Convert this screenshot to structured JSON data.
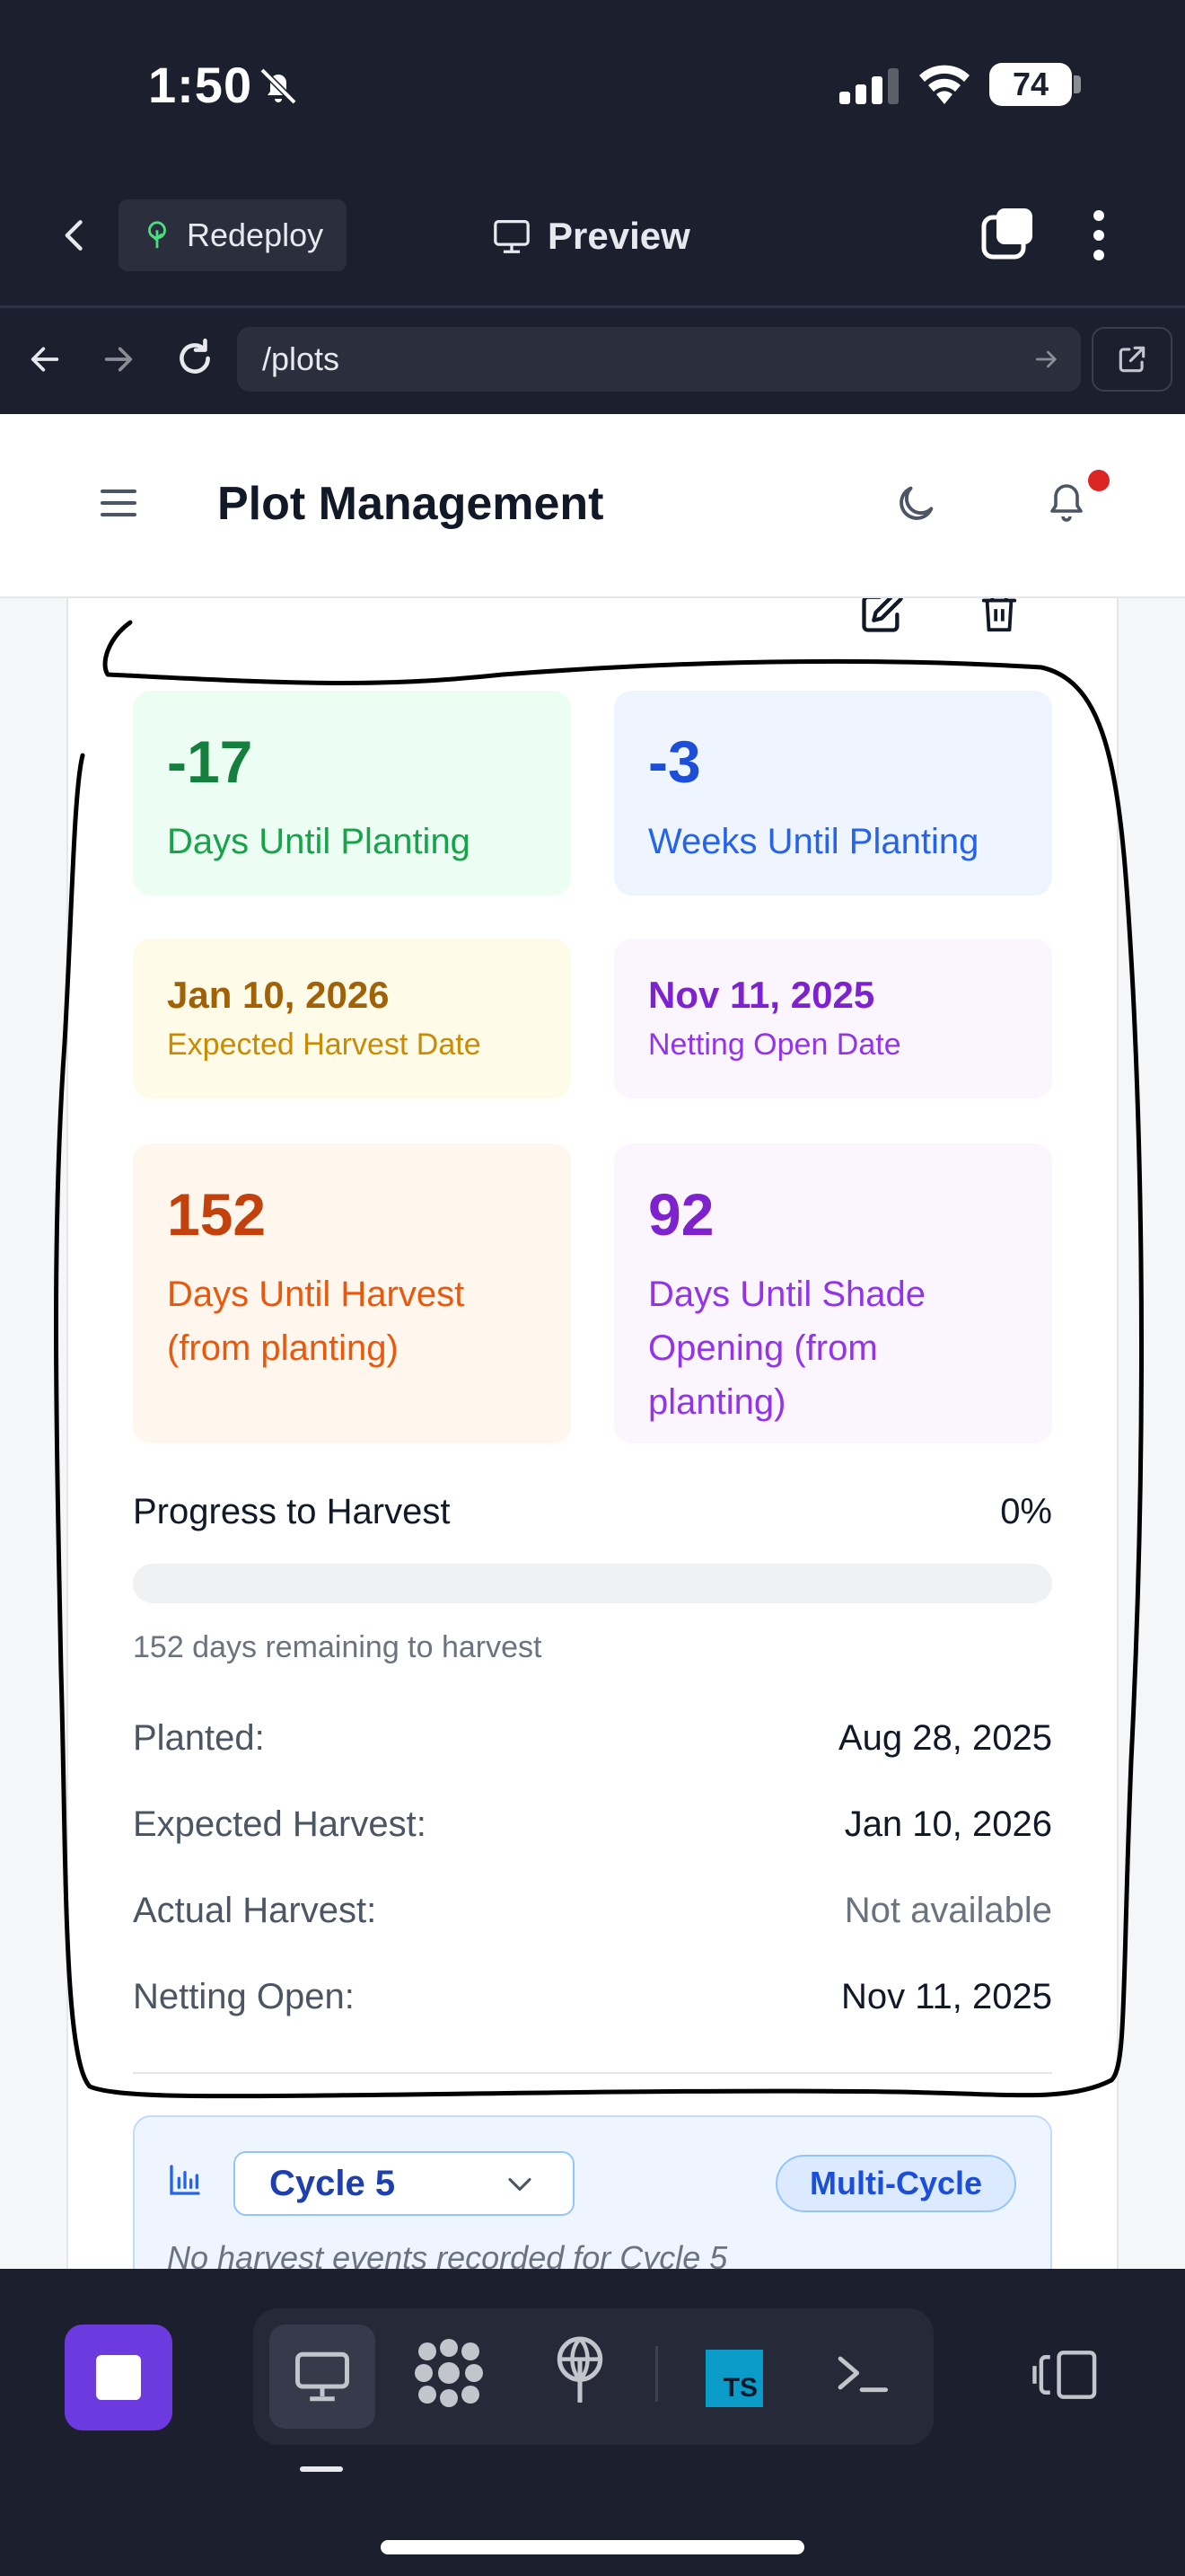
{
  "status_bar": {
    "time": "1:50",
    "battery": "74"
  },
  "app_bar": {
    "redeploy_label": "Redeploy",
    "preview_label": "Preview"
  },
  "url_bar": {
    "url": "/plots"
  },
  "page": {
    "title": "Plot Management",
    "stats": [
      {
        "value": "-17",
        "label": "Days Until Planting"
      },
      {
        "value": "-3",
        "label": "Weeks Until Planting"
      },
      {
        "value": "Jan 10, 2026",
        "label": "Expected Harvest Date"
      },
      {
        "value": "Nov 11, 2025",
        "label": "Netting Open Date"
      },
      {
        "value": "152",
        "label": "Days Until Harvest (from planting)"
      },
      {
        "value": "92",
        "label": "Days Until Shade Opening (from planting)"
      }
    ],
    "progress": {
      "label": "Progress to Harvest",
      "percent_text": "0%",
      "percent": 0,
      "remaining_text": "152 days remaining to harvest"
    },
    "details": [
      {
        "key": "Planted:",
        "value": "Aug 28, 2025"
      },
      {
        "key": "Expected Harvest:",
        "value": "Jan 10, 2026"
      },
      {
        "key": "Actual Harvest:",
        "value": "Not available"
      },
      {
        "key": "Netting Open:",
        "value": "Nov 11, 2025"
      }
    ],
    "cycle": {
      "selected": "Cycle 5",
      "badge": "Multi-Cycle",
      "empty_text": "No harvest events recorded for Cycle 5"
    }
  },
  "bottom_bar": {
    "ts_label": "TS"
  },
  "colors": {
    "accent": "#6d3ae0",
    "notification_dot": "#dc2626",
    "progress_fill": "#16a34a"
  }
}
